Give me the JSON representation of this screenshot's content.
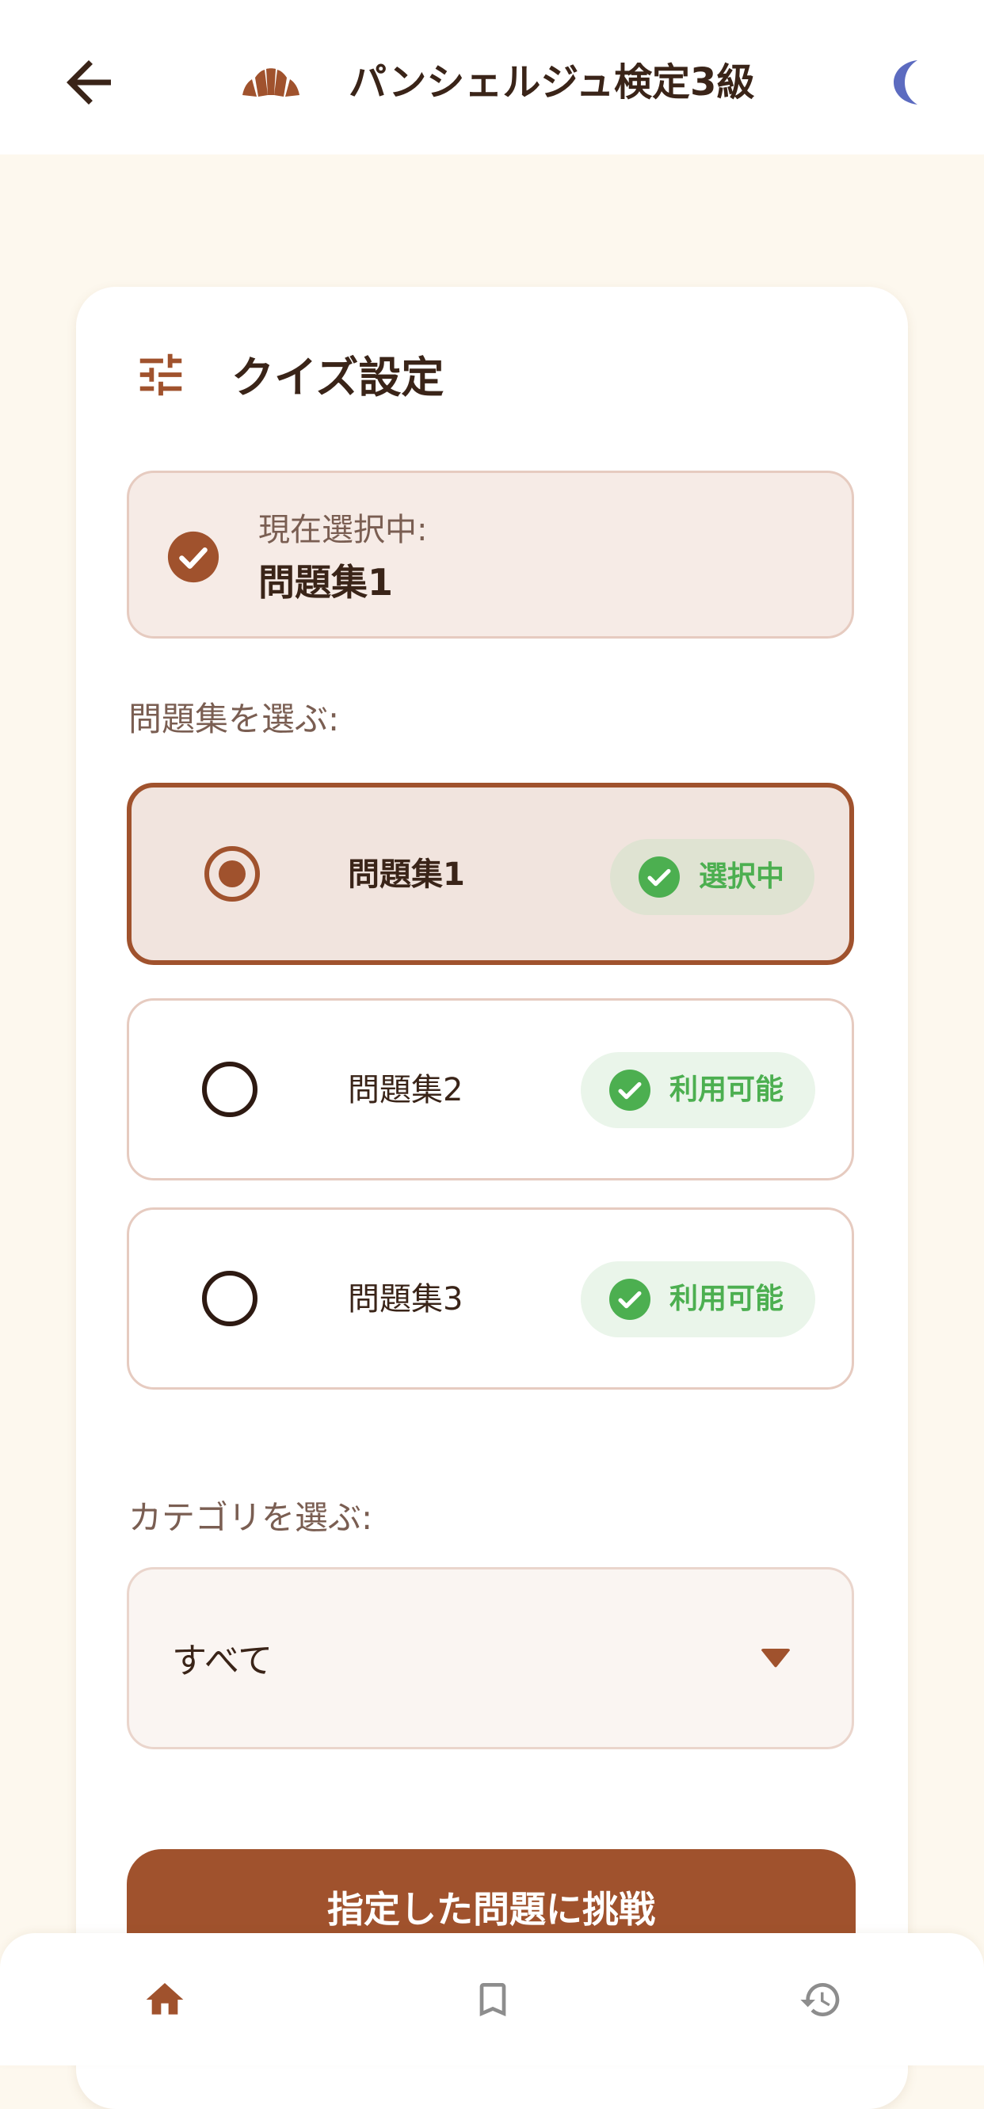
{
  "app_bar": {
    "title": "パンシェルジュ検定3級",
    "back_icon": "arrow-back-icon",
    "logo_icon": "croissant-icon",
    "theme_icon": "moon-icon",
    "moon_color": "#5C6BC0"
  },
  "quiz_settings": {
    "title": "クイズ設定",
    "icon": "tune-icon",
    "current": {
      "label": "現在選択中:",
      "value": "問題集1"
    },
    "question_set_label": "問題集を選ぶ:",
    "question_sets": [
      {
        "name": "問題集1",
        "selected": true,
        "status": "選択中"
      },
      {
        "name": "問題集2",
        "selected": false,
        "status": "利用可能"
      },
      {
        "name": "問題集3",
        "selected": false,
        "status": "利用可能"
      }
    ],
    "category_label": "カテゴリを選ぶ:",
    "category_value": "すべて",
    "start_button": "指定した問題に挑戦"
  },
  "bottom_nav": {
    "items": [
      {
        "icon": "home-icon",
        "active": true
      },
      {
        "icon": "bookmark-icon",
        "active": false
      },
      {
        "icon": "history-icon",
        "active": false
      }
    ]
  },
  "colors": {
    "brand": "#A0522D",
    "background": "#FDF8EE",
    "success": "#4CAF50",
    "text": "#3A2418",
    "muted_text": "#7A5E52"
  }
}
